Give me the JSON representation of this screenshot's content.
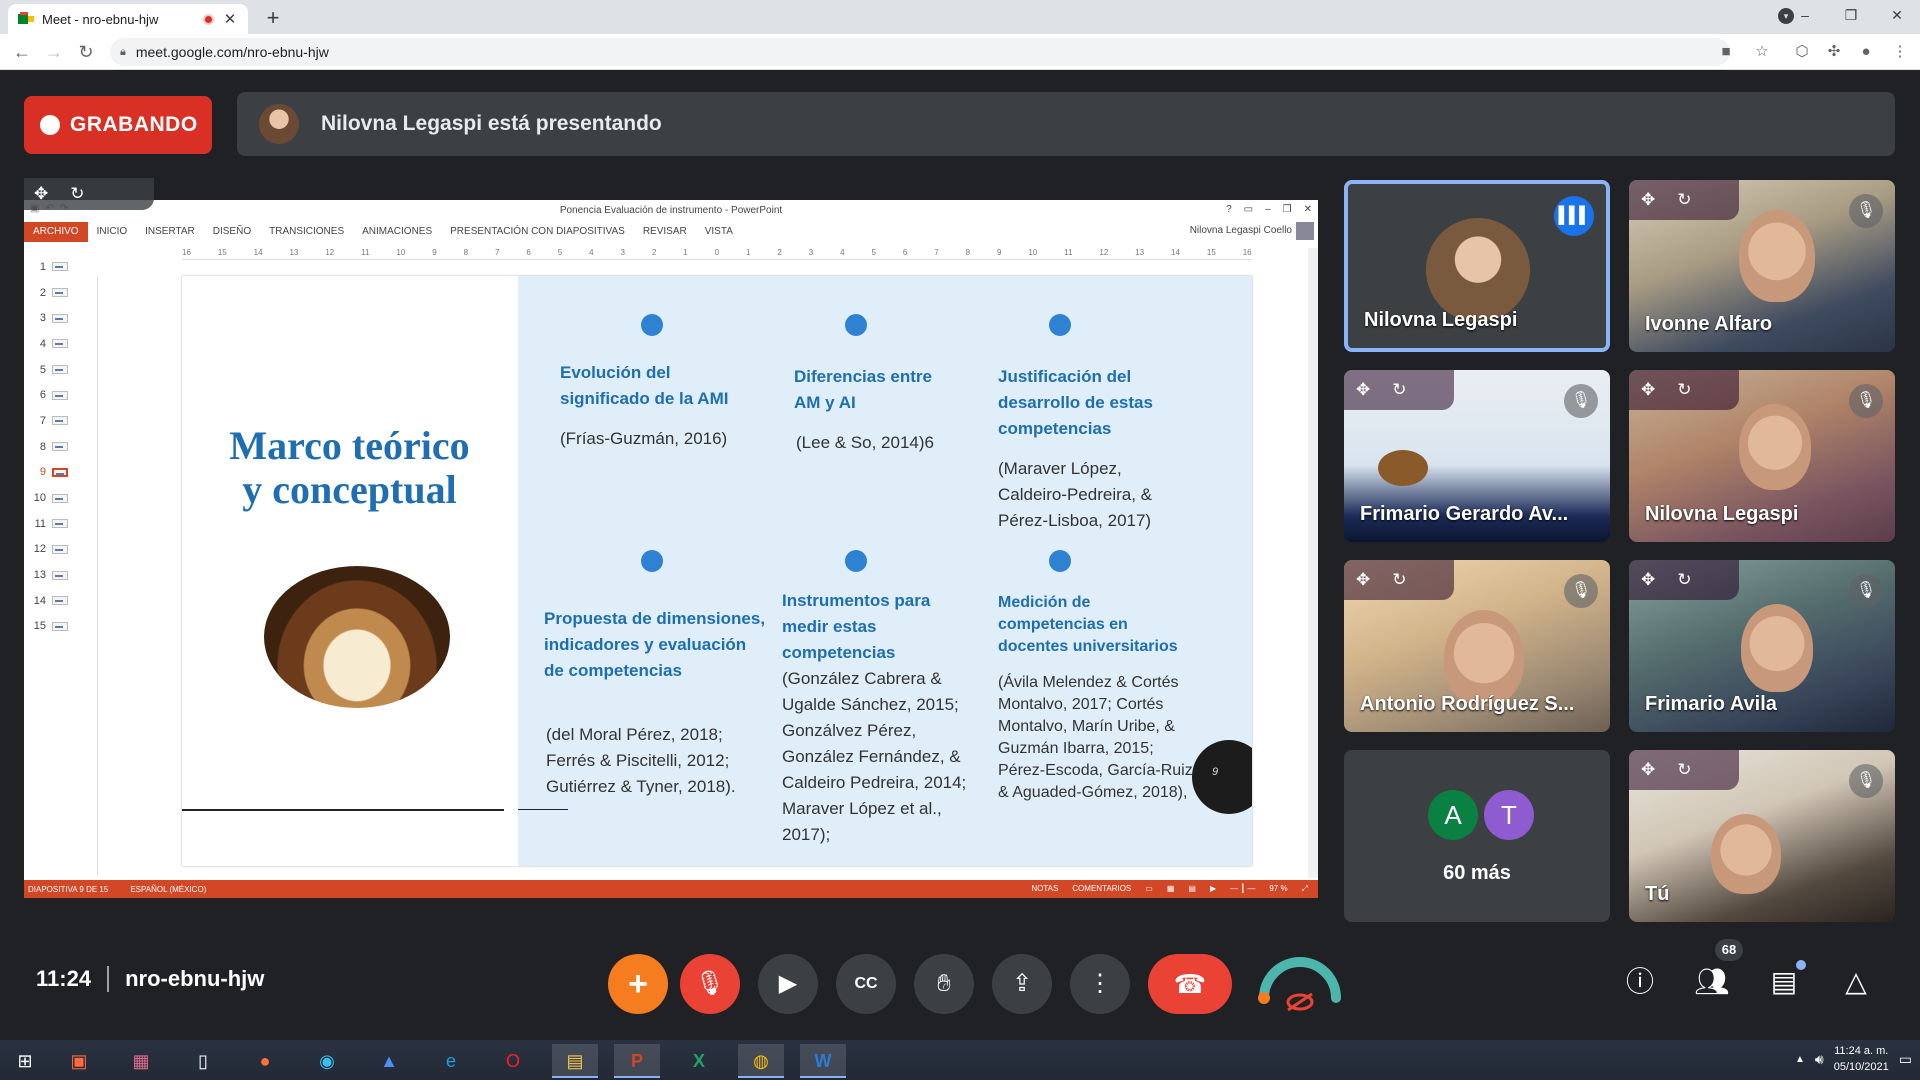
{
  "browser": {
    "tab_title": "Meet - nro-ebnu-hjw",
    "url": "meet.google.com/nro-ebnu-hjw"
  },
  "meet": {
    "recording_label": "GRABANDO",
    "presenting_text": "Nilovna Legaspi está presentando",
    "time": "11:24",
    "meeting_code": "nro-ebnu-hjw",
    "participant_count": "68",
    "others_label": "60 más",
    "others_avatars": [
      {
        "letter": "A",
        "color": "#0b8043"
      },
      {
        "letter": "T",
        "color": "#8e5bd1"
      }
    ]
  },
  "tiles": [
    {
      "name": "Nilovna Legaspi",
      "speaking": true
    },
    {
      "name": "Ivonne Alfaro",
      "muted": true
    },
    {
      "name": "Frimario Gerardo Av...",
      "muted": true
    },
    {
      "name": "Nilovna Legaspi",
      "muted": true
    },
    {
      "name": "Antonio Rodríguez S...",
      "muted": true
    },
    {
      "name": "Frimario Avila",
      "muted": true
    },
    {
      "name": "Tú",
      "muted": true
    }
  ],
  "ppt": {
    "window_title": "Ponencia Evaluación de instrumento - PowerPoint",
    "user": "Nilovna Legaspi Coello",
    "ribbon_tabs": [
      "ARCHIVO",
      "INICIO",
      "INSERTAR",
      "DISEÑO",
      "TRANSICIONES",
      "ANIMACIONES",
      "PRESENTACIÓN CON DIAPOSITIVAS",
      "REVISAR",
      "VISTA"
    ],
    "ruler": [
      "16",
      "15",
      "14",
      "13",
      "12",
      "11",
      "10",
      "9",
      "8",
      "7",
      "6",
      "5",
      "4",
      "3",
      "2",
      "1",
      "0",
      "1",
      "2",
      "3",
      "4",
      "5",
      "6",
      "7",
      "8",
      "9",
      "10",
      "11",
      "12",
      "13",
      "14",
      "15",
      "16"
    ],
    "slide_numbers": [
      "1",
      "2",
      "3",
      "4",
      "5",
      "6",
      "7",
      "8",
      "9",
      "10",
      "11",
      "12",
      "13",
      "14",
      "15"
    ],
    "selected_slide": "9",
    "status_slide": "DIAPOSITIVA 9 DE 15",
    "status_lang": "ESPAÑOL (MÉXICO)",
    "status_notes": "NOTAS",
    "status_comments": "COMENTARIOS",
    "zoom": "97 %",
    "slide": {
      "title_line1": "Marco teórico",
      "title_line2": "y conceptual",
      "page": "9",
      "blocks": [
        {
          "title": "Evolución del significado de la AMI",
          "ref": "(Frías-Guzmán, 2016)"
        },
        {
          "title": "Diferencias entre AM y AI",
          "ref": "(Lee & So, 2014)6"
        },
        {
          "title": "Justificación del desarrollo de estas competencias",
          "ref": "(Maraver López, Caldeiro-Pedreira, & Pérez-Lisboa, 2017)"
        },
        {
          "title": "Propuesta de dimensiones, indicadores y evaluación de competencias",
          "ref": "(del Moral Pérez, 2018; Ferrés & Piscitelli, 2012; Gutiérrez & Tyner, 2018)."
        },
        {
          "title": "Instrumentos para medir estas competencias",
          "ref": "(González Cabrera & Ugalde Sánchez, 2015; Gonzálvez Pérez, González Fernández, & Caldeiro Pedreira, 2014; Maraver López et al., 2017);"
        },
        {
          "title": "Medición de competencias en docentes universitarios",
          "ref": "(Ávila Melendez & Cortés Montalvo, 2017; Cortés Montalvo, Marín Uribe, & Guzmán Ibarra, 2015; Pérez-Escoda, García-Ruiz, & Aguaded-Gómez, 2018),"
        }
      ]
    }
  },
  "taskbar": {
    "time": "11:24 a. m.",
    "date": "05/10/2021"
  },
  "colors": {
    "record": "#d93025",
    "accent": "#8ab4f8",
    "end_call": "#ea4335",
    "ppt_orange": "#d24726",
    "slide_blue": "#1f6eb2"
  }
}
